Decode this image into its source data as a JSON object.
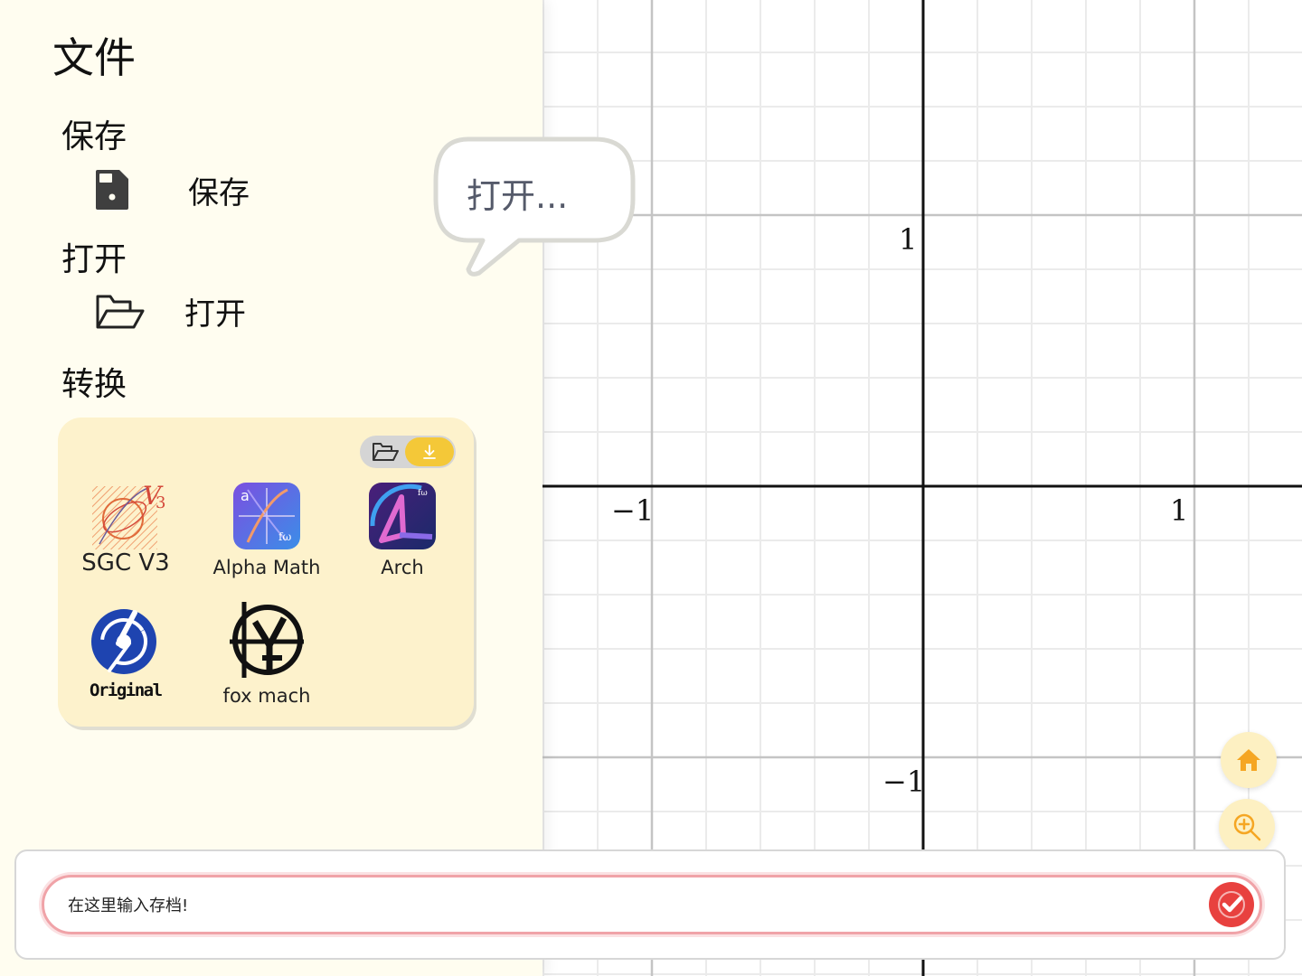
{
  "graph": {
    "ticks": {
      "x_neg": "−1",
      "x_pos": "1",
      "y_pos": "1",
      "y_neg": "−1"
    }
  },
  "sidebar": {
    "title": "文件",
    "sections": {
      "save": {
        "heading": "保存",
        "item": {
          "label": "保存",
          "icon": "save-file-icon"
        }
      },
      "open": {
        "heading": "打开",
        "item": {
          "label": "打开",
          "icon": "folder-open-icon"
        }
      },
      "convert": {
        "heading": "转换"
      }
    },
    "apps": [
      {
        "name": "SGC V3",
        "icon": "sgc-v3-logo"
      },
      {
        "name": "Alpha Math",
        "icon": "alpha-math-logo"
      },
      {
        "name": "Arch",
        "icon": "arch-logo"
      },
      {
        "name": "",
        "icon": "original-logo",
        "logo_text": "Original"
      },
      {
        "name": "fox mach",
        "icon": "fox-mach-logo"
      }
    ]
  },
  "bubble": {
    "text": "打开..."
  },
  "input": {
    "placeholder": "在这里输入存档!"
  },
  "colors": {
    "sidebar_bg": "#fffdf0",
    "card_bg": "#fdf2cc",
    "accent_yellow": "#f4c838",
    "confirm_red": "#e8413f",
    "home_orange": "#f5a623"
  }
}
